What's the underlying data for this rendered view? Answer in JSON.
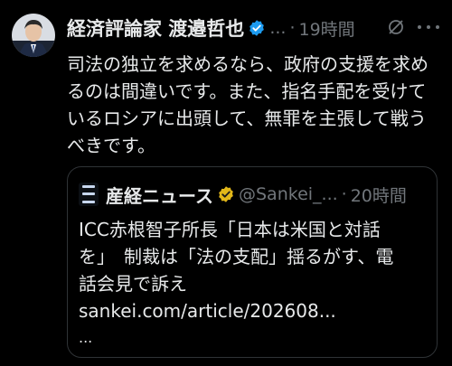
{
  "tweet": {
    "author_name": "経済評論家 渡邉哲也",
    "handle": "...",
    "time": "19時間",
    "text": "司法の独立を求めるなら、政府の支援を求めるのは間違いです。また、指名手配を受けているロシアに出頭して、無罪を主張して戦うべきです。"
  },
  "quote": {
    "author_name": "産経ニュース",
    "handle": "@Sankei_...",
    "time": "20時間",
    "lines": [
      "ICC赤根智子所長「日本は米国と対話",
      "を」　制裁は「法の支配」揺るがす、電",
      "話会見で訴え",
      "sankei.com/article/202608..."
    ],
    "ellipsis": "..."
  },
  "icons": {
    "verified": "verified-badge-icon",
    "mute": "mute-icon",
    "more": "more-dots-icon",
    "logo": "sankei-logo-icon"
  },
  "colors": {
    "background": "#000000",
    "text": "#e7e9ea",
    "muted": "#71767b",
    "verified_blue": "#1d9bf0",
    "verified_gold": "#e2b719",
    "border": "#2f3336"
  }
}
